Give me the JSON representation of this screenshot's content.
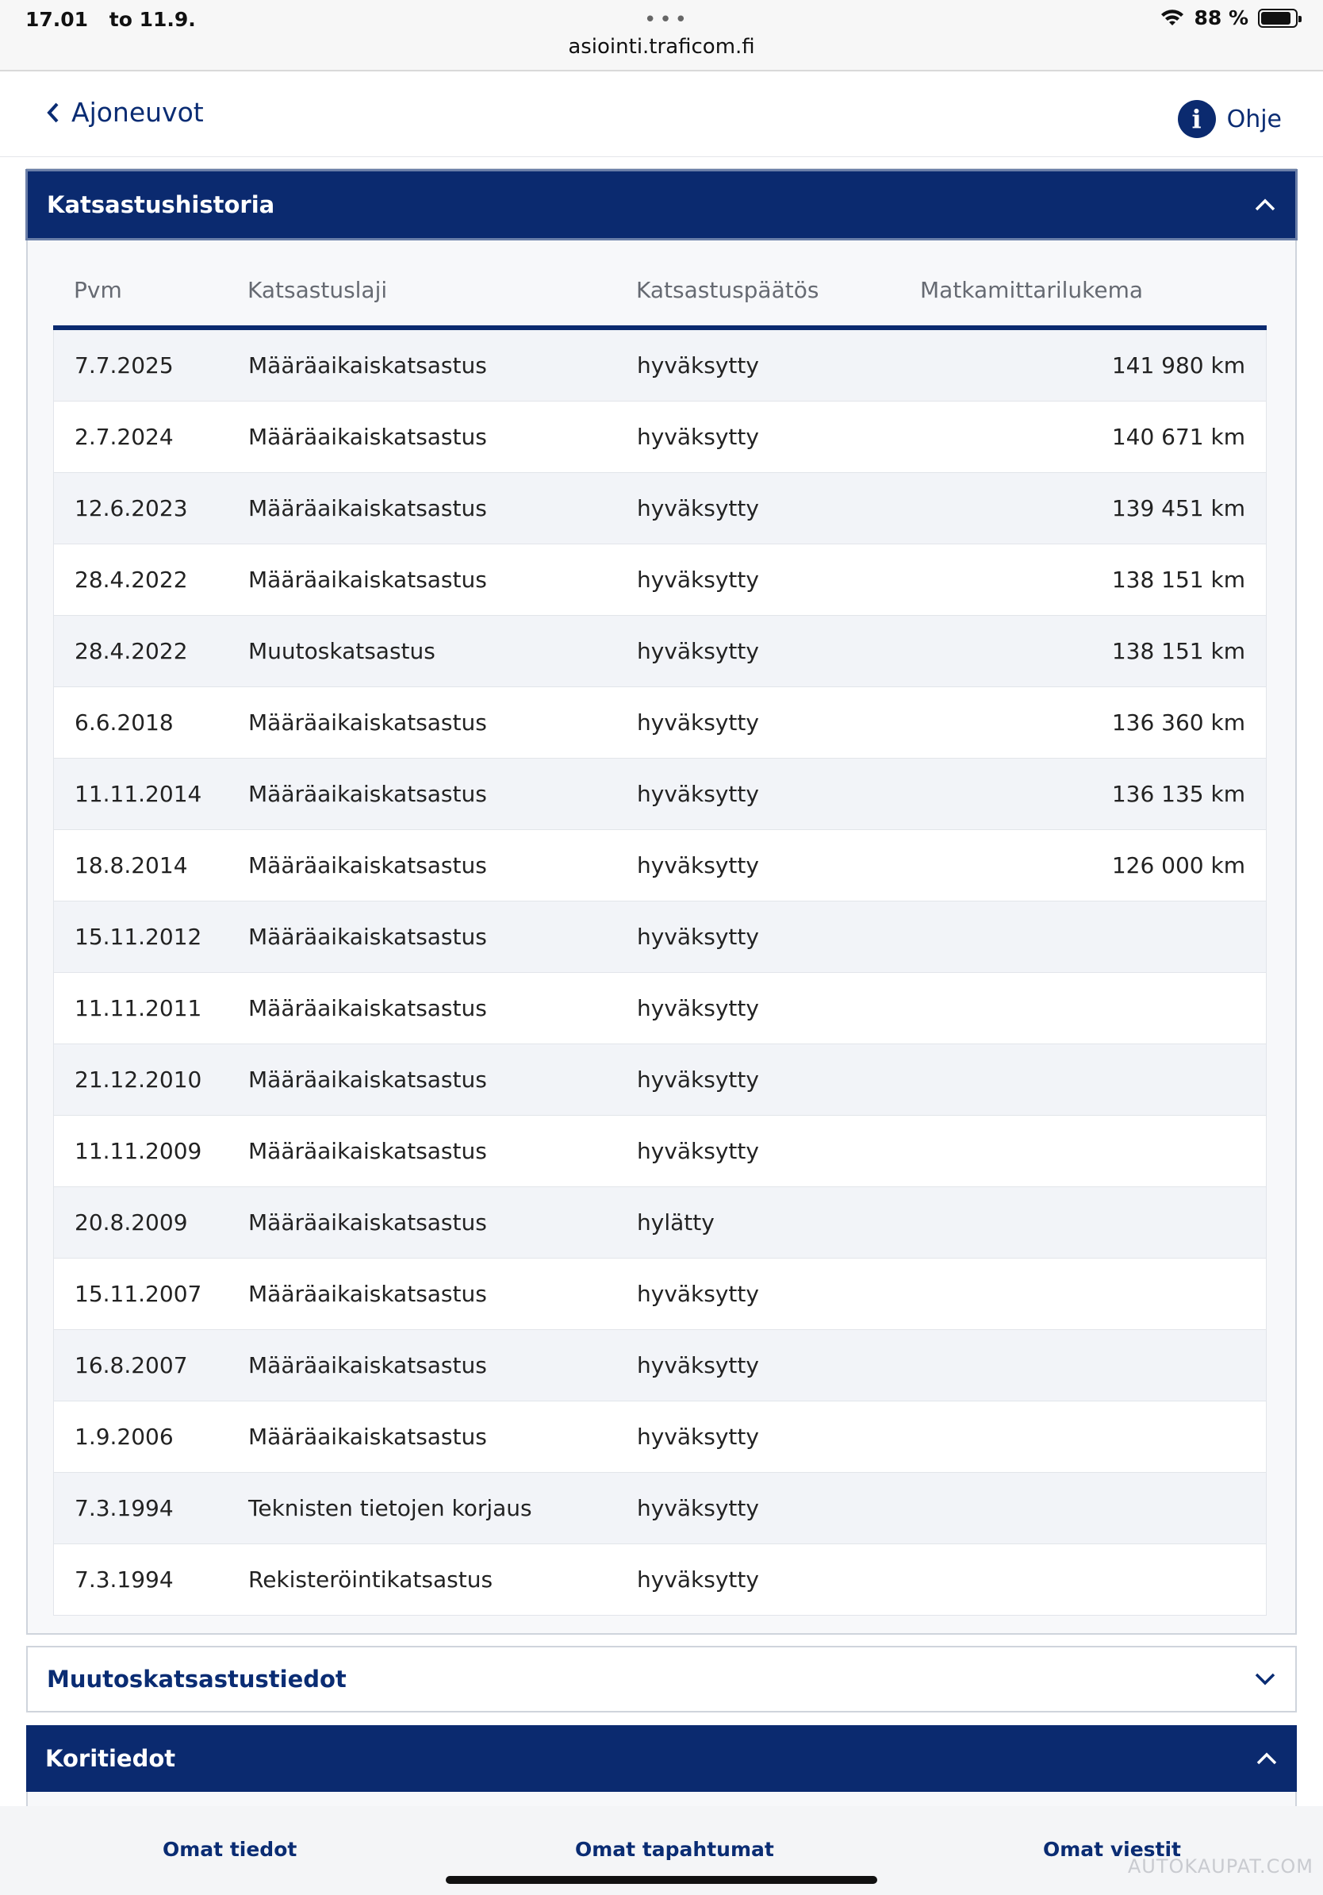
{
  "status_bar": {
    "time": "17.01",
    "date": "to 11.9.",
    "url": "asiointi.traficom.fi",
    "battery_percent": "88 %",
    "battery_level": 0.88
  },
  "header": {
    "back_label": "Ajoneuvot",
    "help_label": "Ohje"
  },
  "inspection_history": {
    "title": "Katsastushistoria",
    "columns": [
      "Pvm",
      "Katsastuslaji",
      "Katsastuspäätös",
      "Matkamittarilukema"
    ],
    "rows": [
      [
        "7.7.2025",
        "Määräaikaiskatsastus",
        "hyväksytty",
        "141 980 km"
      ],
      [
        "2.7.2024",
        "Määräaikaiskatsastus",
        "hyväksytty",
        "140 671 km"
      ],
      [
        "12.6.2023",
        "Määräaikaiskatsastus",
        "hyväksytty",
        "139 451 km"
      ],
      [
        "28.4.2022",
        "Määräaikaiskatsastus",
        "hyväksytty",
        "138 151 km"
      ],
      [
        "28.4.2022",
        "Muutoskatsastus",
        "hyväksytty",
        "138 151 km"
      ],
      [
        "6.6.2018",
        "Määräaikaiskatsastus",
        "hyväksytty",
        "136 360 km"
      ],
      [
        "11.11.2014",
        "Määräaikaiskatsastus",
        "hyväksytty",
        "136 135 km"
      ],
      [
        "18.8.2014",
        "Määräaikaiskatsastus",
        "hyväksytty",
        "126 000 km"
      ],
      [
        "15.11.2012",
        "Määräaikaiskatsastus",
        "hyväksytty",
        ""
      ],
      [
        "11.11.2011",
        "Määräaikaiskatsastus",
        "hyväksytty",
        ""
      ],
      [
        "21.12.2010",
        "Määräaikaiskatsastus",
        "hyväksytty",
        ""
      ],
      [
        "11.11.2009",
        "Määräaikaiskatsastus",
        "hyväksytty",
        ""
      ],
      [
        "20.8.2009",
        "Määräaikaiskatsastus",
        "hylätty",
        ""
      ],
      [
        "15.11.2007",
        "Määräaikaiskatsastus",
        "hyväksytty",
        ""
      ],
      [
        "16.8.2007",
        "Määräaikaiskatsastus",
        "hyväksytty",
        ""
      ],
      [
        "1.9.2006",
        "Määräaikaiskatsastus",
        "hyväksytty",
        ""
      ],
      [
        "7.3.1994",
        "Teknisten tietojen korjaus",
        "hyväksytty",
        ""
      ],
      [
        "7.3.1994",
        "Rekisteröintikatsastus",
        "hyväksytty",
        ""
      ]
    ]
  },
  "sections": {
    "modification_title": "Muutoskatsastustiedot",
    "body_title": "Koritiedot"
  },
  "bottom_nav": [
    "Omat tiedot",
    "Omat tapahtumat",
    "Omat viestit"
  ],
  "watermark": "AUTOKAUPAT.COM",
  "colors": {
    "navy": "#0b2a6f",
    "row_alt": "#f2f4f8"
  },
  "icons": [
    "wifi-icon",
    "battery-icon",
    "chevron-left-icon",
    "info-icon",
    "chevron-up-icon",
    "chevron-down-icon"
  ]
}
